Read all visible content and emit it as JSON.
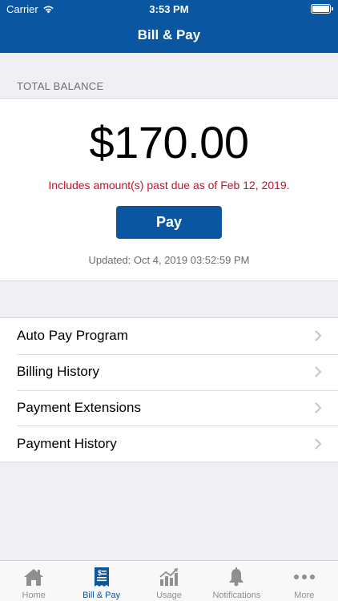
{
  "status_bar": {
    "carrier": "Carrier",
    "time": "3:53 PM"
  },
  "nav": {
    "title": "Bill & Pay"
  },
  "balance": {
    "header": "TOTAL BALANCE",
    "amount": "$170.00",
    "past_due_notice": "Includes amount(s) past due as of Feb 12, 2019.",
    "pay_label": "Pay",
    "updated": "Updated: Oct 4, 2019 03:52:59 PM"
  },
  "menu": {
    "items": [
      {
        "label": "Auto Pay Program"
      },
      {
        "label": "Billing History"
      },
      {
        "label": "Payment Extensions"
      },
      {
        "label": "Payment History"
      }
    ]
  },
  "tabs": [
    {
      "label": "Home",
      "icon": "home-icon"
    },
    {
      "label": "Bill & Pay",
      "icon": "bill-icon",
      "active": true
    },
    {
      "label": "Usage",
      "icon": "usage-chart-icon"
    },
    {
      "label": "Notifications",
      "icon": "bell-icon"
    },
    {
      "label": "More",
      "icon": "more-dots-icon"
    }
  ],
  "colors": {
    "brand": "#0a56a0",
    "alert": "#c8102e",
    "inactive_tab": "#8e8e93"
  }
}
